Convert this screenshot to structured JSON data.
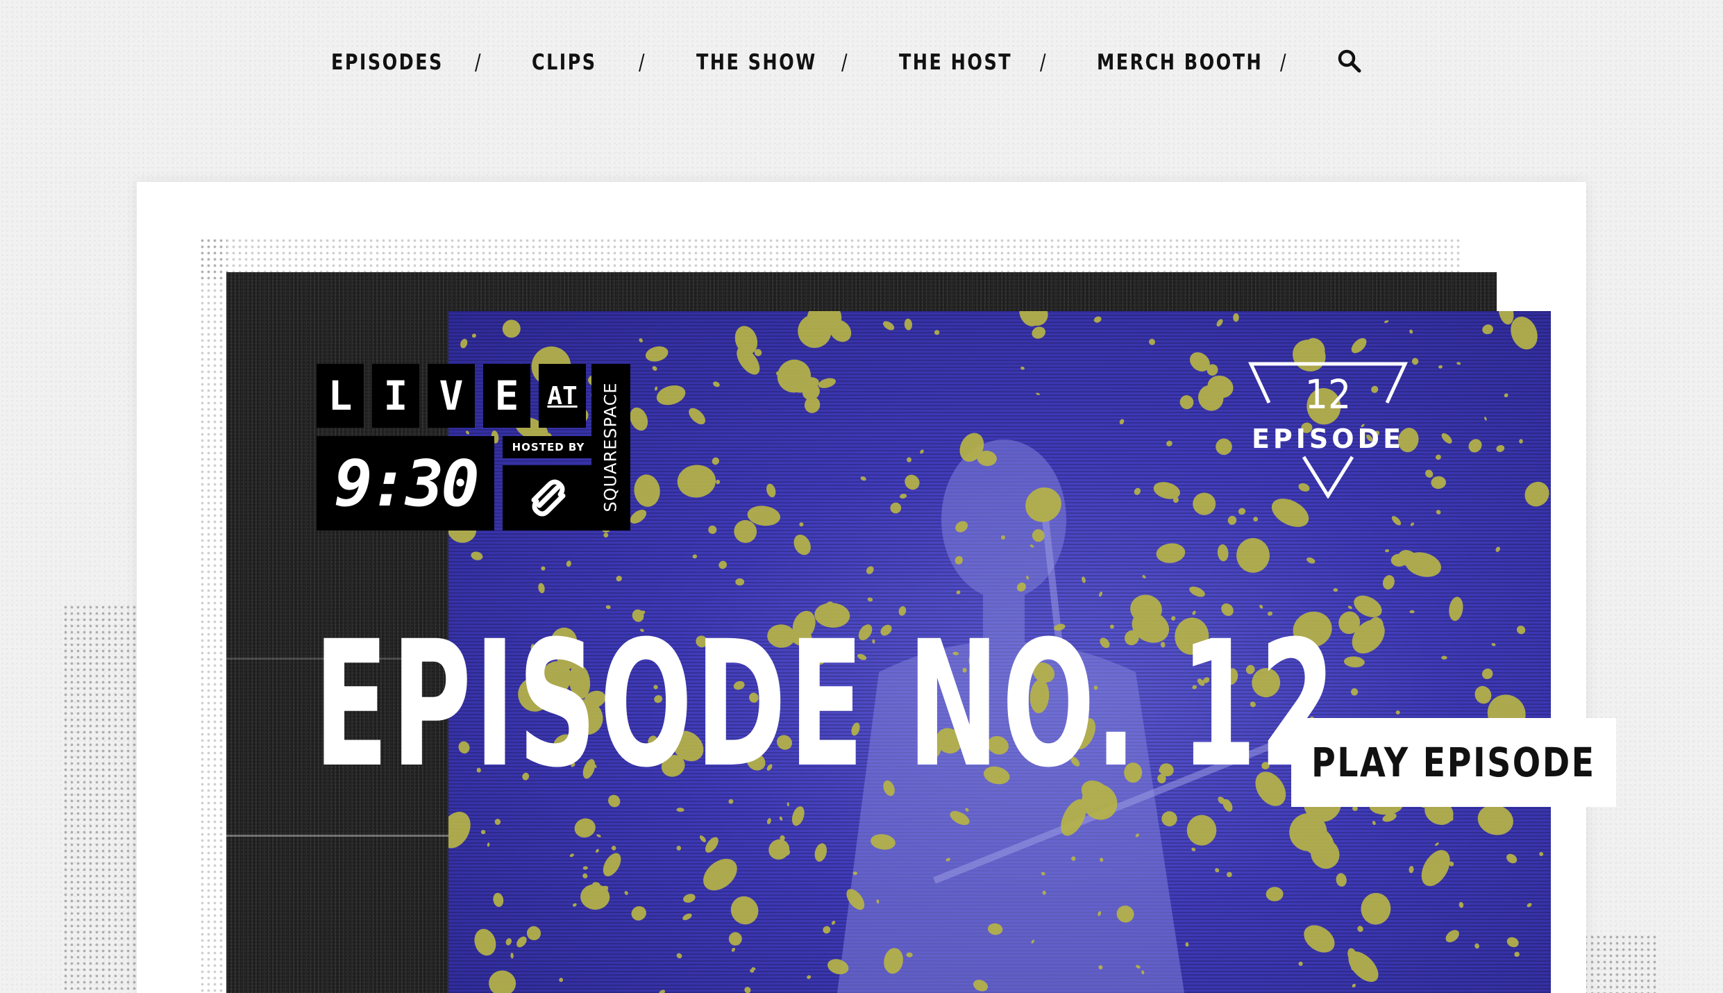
{
  "nav": {
    "items": [
      {
        "label": "EPISODES"
      },
      {
        "label": "CLIPS"
      },
      {
        "label": "THE SHOW"
      },
      {
        "label": "THE HOST"
      },
      {
        "label": "MERCH BOOTH"
      }
    ],
    "separator": "/",
    "search_icon": "search-icon"
  },
  "logo": {
    "letters": [
      "L",
      "I",
      "V",
      "E"
    ],
    "at": "AT",
    "time": "9:30",
    "hosted_by": "HOSTED BY",
    "sponsor": "SQUARESPACE",
    "sponsor_icon": "squarespace-logo-icon"
  },
  "badge": {
    "number": "12",
    "label": "EPISODE"
  },
  "hero": {
    "title": "EPISODE NO. 12",
    "play_label": "PLAY EPISODE"
  },
  "colors": {
    "photo_tint": "#3f3ab8",
    "splatter": "#b8b446",
    "dark_block": "#1f1f1f",
    "background": "#f1f1f1"
  }
}
